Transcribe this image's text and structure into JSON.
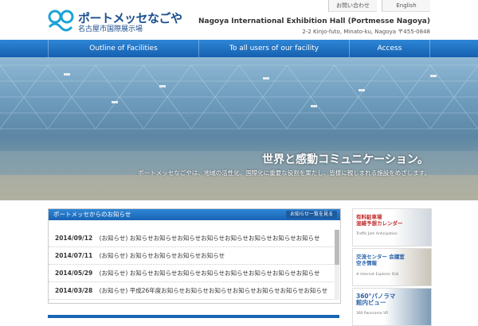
{
  "header": {
    "logo_jp": "ポートメッセなごや",
    "logo_sub": "名古屋市国際展示場",
    "top_links": [
      "お問い合わせ",
      "English"
    ],
    "org_name": "Nagoya International Exhibition Hall (Portmesse Nagoya)",
    "address": "2-2 Kinjo-futo, Minato-ku, Nagoya 〒455-0848"
  },
  "nav": {
    "items": [
      "Outline of Facilities",
      "To all users of our facility",
      "Access"
    ]
  },
  "hero": {
    "headline": "世界と感動コミュニケーション。",
    "sub": "ポートメッセなごやは、地域の活性化、国際化に重要な役割を果たし、皆様に親しまれる施設をめざします。"
  },
  "news": {
    "title": "ポートメッセからのお知らせ",
    "more_label": "お知らせ一覧を見る",
    "items": [
      {
        "date": "2014/09/12",
        "tag": "(お知らせ)",
        "text": "お知らせお知らせお知らせお知らせお知らせお知らせお知らせお知らせ"
      },
      {
        "date": "2014/07/11",
        "tag": "(お知らせ)",
        "text": "お知らせお知らせお知らせお知らせ"
      },
      {
        "date": "2014/05/29",
        "tag": "(お知らせ)",
        "text": "お知らせお知らせお知らせお知らせお知らせお知らせお知らせお知らせ"
      },
      {
        "date": "2014/03/28",
        "tag": "(お知らせ)",
        "text": "平成26年度お知らせお知らせお知らせお知らせお知らせお知らせお知らせ"
      }
    ]
  },
  "banners": [
    {
      "line1": "有料駐車場",
      "line2": "混雑予想カレンダー",
      "caption": "Traffic Jam Anticipation"
    },
    {
      "line1": "交流センター 会議室",
      "line2": "空き情報",
      "caption": "※ Internet Explorer のみ"
    },
    {
      "line1": "360°パノラマ",
      "line2": "館内ビュー",
      "caption": "360 Panorama VR"
    }
  ],
  "colors": {
    "nav": "#1a64b4",
    "accent_red": "#c22a2a"
  }
}
